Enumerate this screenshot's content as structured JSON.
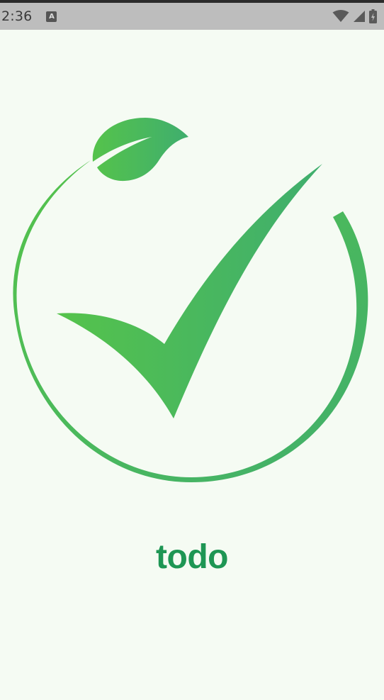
{
  "status_bar": {
    "time": "2:36",
    "notification_icon": "app-notification-icon",
    "icons": [
      "wifi-icon",
      "signal-icon",
      "battery-icon"
    ]
  },
  "splash": {
    "app_name": "todo",
    "logo_icon": "leaf-checkmark-logo"
  },
  "colors": {
    "background": "#f5fbf3",
    "status_bar": "#bdbdbd",
    "brand_green": "#1e9654",
    "logo_green_light": "#55c34b",
    "logo_green_dark": "#3fae6e"
  }
}
